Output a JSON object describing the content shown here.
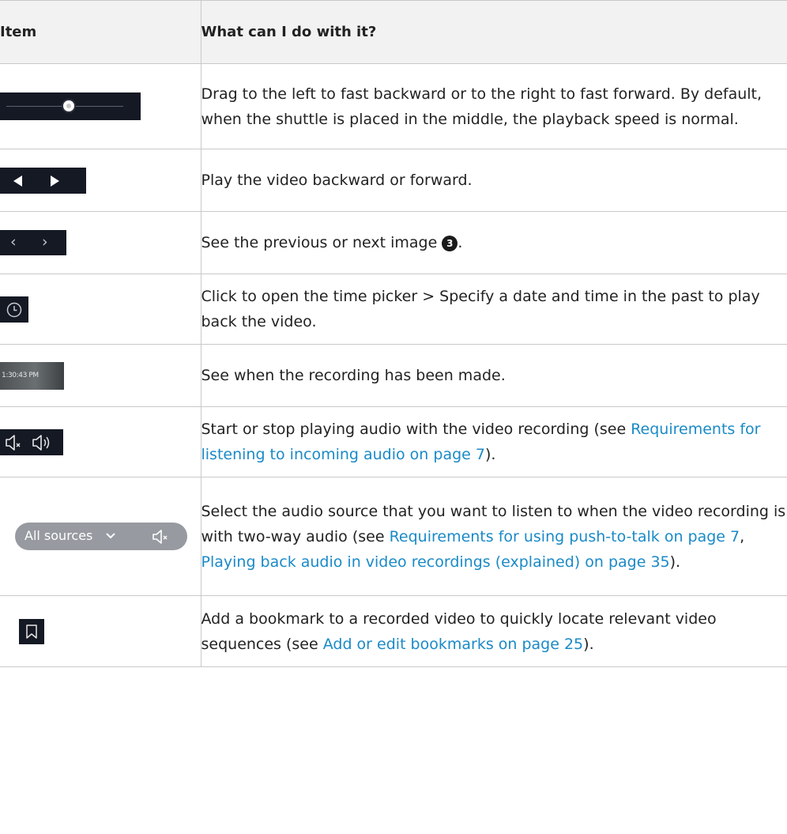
{
  "table": {
    "headers": {
      "item": "Item",
      "description": "What can I do with it?"
    },
    "rows": [
      {
        "icon": "shuttle-slider",
        "description": "Drag to the left to fast backward or to the right to fast forward. By default, when the shuttle is placed in the middle, the playback speed is normal."
      },
      {
        "icon": "play-backward-forward-buttons",
        "description": "Play the video backward or forward."
      },
      {
        "icon": "previous-next-image-buttons",
        "description_pre": "See the previous or next image ",
        "badge": "3",
        "description_post": "."
      },
      {
        "icon": "clock-icon",
        "description": "Click to open the time picker > Specify a date and time in the past to play back the video."
      },
      {
        "icon": "recording-time",
        "time_text": "1:30:43 PM",
        "description": "See when the recording has been made."
      },
      {
        "icon": "audio-mute-unmute-icons",
        "description_pre": "Start or stop playing audio with the video recording (see ",
        "link1": "Requirements for listening to incoming audio on page 7",
        "description_post": ")."
      },
      {
        "icon": "audio-source-selector",
        "selector_label": "All sources",
        "description_pre": "Select the audio source that you want to listen to when the video recording is with two-way audio (see ",
        "link1": "Requirements for using push-to-talk on page 7",
        "sep": ", ",
        "link2": "Playing back audio in video recordings (explained) on page 35",
        "description_post": ")."
      },
      {
        "icon": "bookmark-icon",
        "description_pre": "Add a bookmark to a recorded video to quickly locate relevant video sequences (see ",
        "link1": "Add or edit bookmarks on page 25",
        "description_post": ")."
      }
    ]
  },
  "colors": {
    "link": "#1a8ac7",
    "icon_strip": "#151924",
    "header_bg": "#f2f2f2",
    "border": "#c9c9c9"
  }
}
